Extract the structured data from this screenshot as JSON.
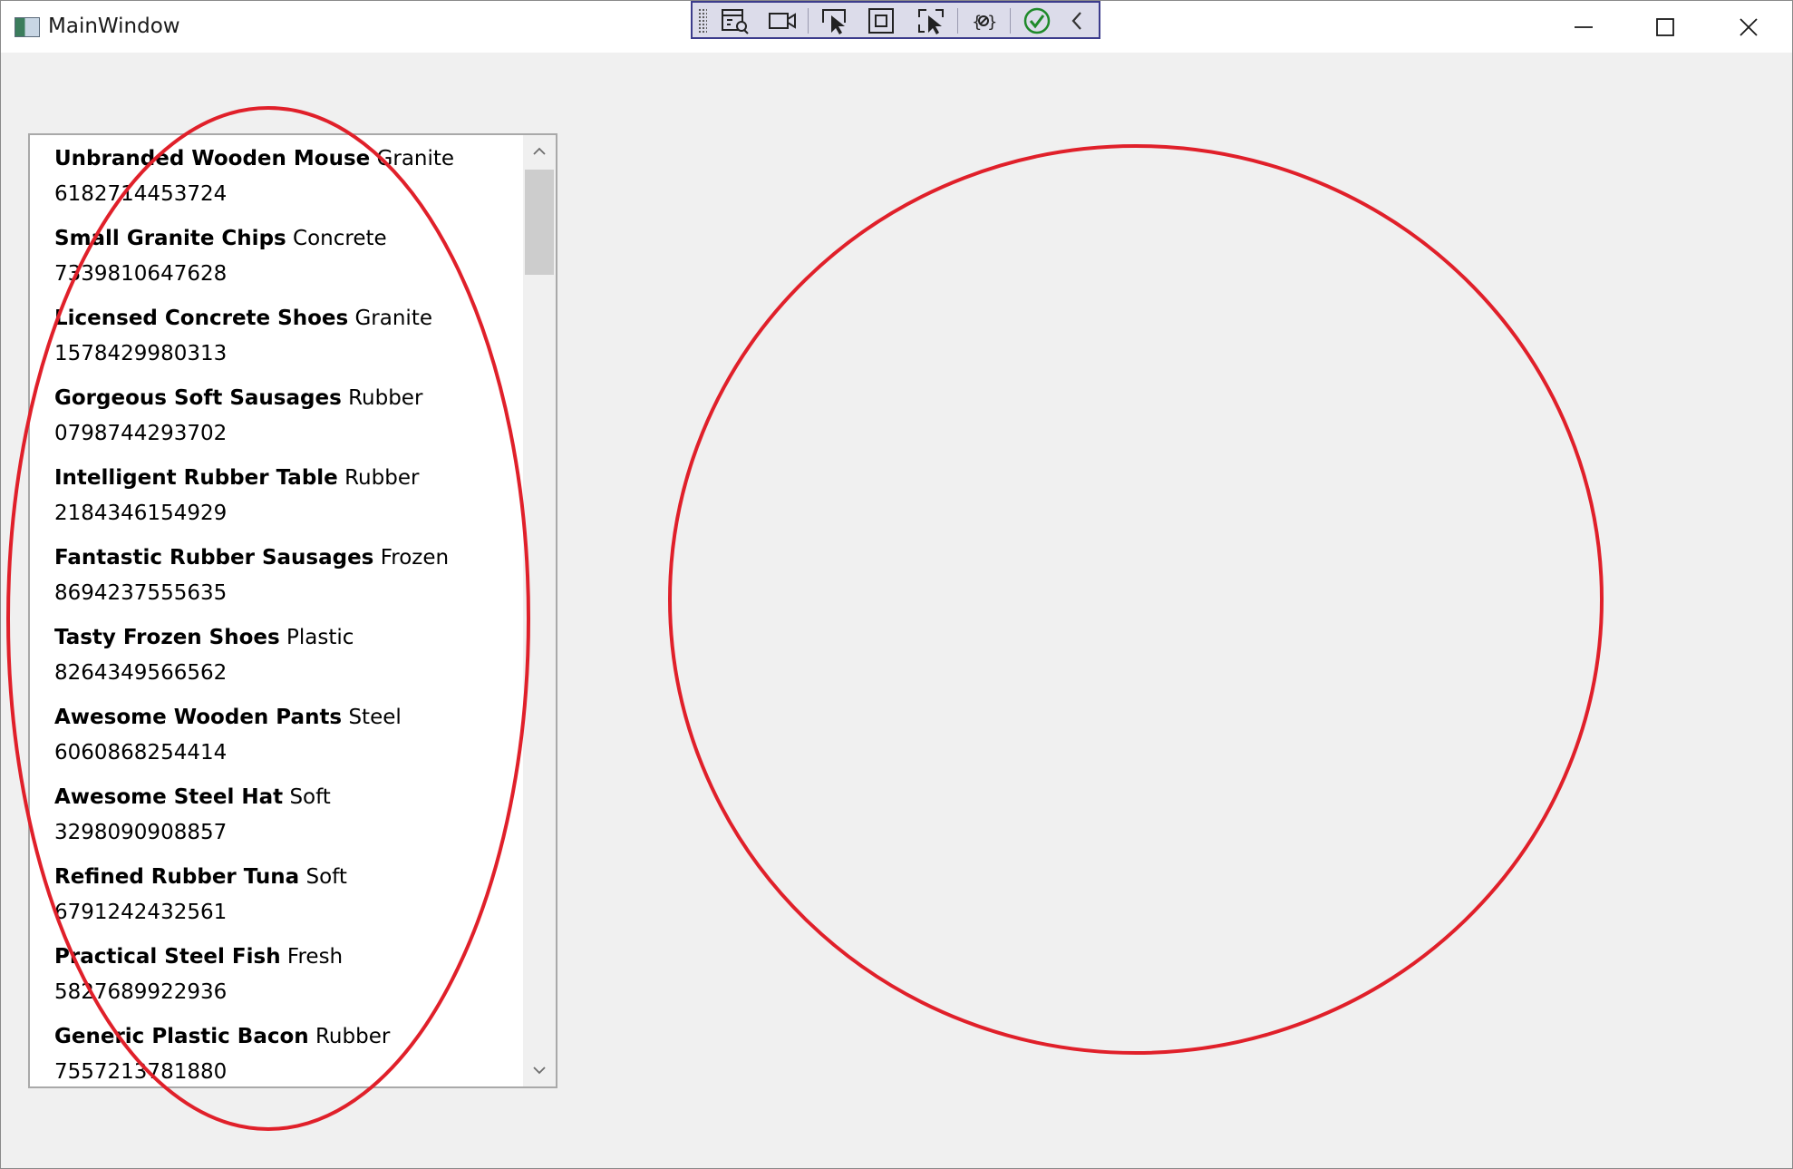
{
  "window": {
    "title": "MainWindow"
  },
  "toolbar": {
    "icons": [
      "go-to-live-visual-tree-icon",
      "record-icon",
      "select-element-icon",
      "display-layout-adorners-icon",
      "track-focused-element-icon",
      "binding-failures-icon",
      "hot-reload-ok-icon",
      "collapse-toolbar-icon"
    ]
  },
  "list": {
    "items": [
      {
        "name": "Unbranded Wooden Mouse",
        "material": "Granite",
        "code": "6182714453724"
      },
      {
        "name": "Small Granite Chips",
        "material": "Concrete",
        "code": "7339810647628"
      },
      {
        "name": "Licensed Concrete Shoes",
        "material": "Granite",
        "code": "1578429980313"
      },
      {
        "name": "Gorgeous Soft Sausages",
        "material": "Rubber",
        "code": "0798744293702"
      },
      {
        "name": "Intelligent Rubber Table",
        "material": "Rubber",
        "code": "2184346154929"
      },
      {
        "name": "Fantastic Rubber Sausages",
        "material": "Frozen",
        "code": "8694237555635"
      },
      {
        "name": "Tasty Frozen Shoes",
        "material": "Plastic",
        "code": "8264349566562"
      },
      {
        "name": "Awesome Wooden Pants",
        "material": "Steel",
        "code": "6060868254414"
      },
      {
        "name": "Awesome Steel Hat",
        "material": "Soft",
        "code": "3298090908857"
      },
      {
        "name": "Refined Rubber Tuna",
        "material": "Soft",
        "code": "6791242432561"
      },
      {
        "name": "Practical Steel Fish",
        "material": "Fresh",
        "code": "5827689922936"
      },
      {
        "name": "Generic Plastic Bacon",
        "material": "Rubber",
        "code": "7557213781880"
      }
    ]
  },
  "colors": {
    "annotation_red": "#e0202a",
    "window_bg": "#f0f0f0",
    "toolbar_bg": "#dcdcea",
    "toolbar_border": "#3c3c8c"
  }
}
